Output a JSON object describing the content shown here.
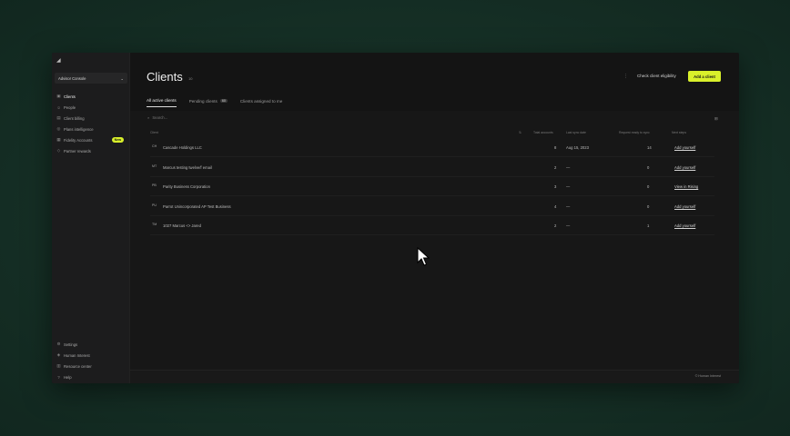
{
  "sidebar": {
    "workspace": "Advisor Console",
    "items": [
      {
        "label": "Clients",
        "icon": "clients-icon",
        "glyph": "▣",
        "active": true
      },
      {
        "label": "People",
        "icon": "people-icon",
        "glyph": "☺"
      },
      {
        "label": "Client billing",
        "icon": "billing-icon",
        "glyph": "▤"
      },
      {
        "label": "Plans intelligence",
        "icon": "plans-icon",
        "glyph": "◎"
      },
      {
        "label": "Fidelity Accounts",
        "icon": "accounts-icon",
        "glyph": "▦",
        "badge": "New"
      },
      {
        "label": "Partner rewards",
        "icon": "rewards-icon",
        "glyph": "◇"
      }
    ],
    "bottom_items": [
      {
        "label": "Settings",
        "icon": "gear-icon",
        "glyph": "⚙"
      },
      {
        "label": "Human Interest",
        "icon": "company-icon",
        "glyph": "◈"
      },
      {
        "label": "Resource center",
        "icon": "book-icon",
        "glyph": "▥"
      },
      {
        "label": "Help",
        "icon": "help-icon",
        "glyph": "?"
      }
    ]
  },
  "header": {
    "title": "Clients",
    "count": "10",
    "check_label": "Check client eligibility",
    "add_label": "Add a client"
  },
  "tabs": [
    {
      "label": "All active clients",
      "active": true
    },
    {
      "label": "Pending clients",
      "count": "60"
    },
    {
      "label": "Clients assigned to me"
    }
  ],
  "search": {
    "placeholder": "Search..."
  },
  "table": {
    "columns": [
      "Client",
      "Total accounts",
      "Last sync date",
      "Request ready to sync",
      "Next steps"
    ],
    "rows": [
      {
        "initials": "CH",
        "client": "Cascade Holdings LLC",
        "accounts": "8",
        "date": "Aug 15, 2023",
        "ready": "14",
        "action": "Add yourself"
      },
      {
        "initials": "MT",
        "client": "Marcus testing twelve/f email",
        "accounts": "2",
        "date": "—",
        "ready": "0",
        "action": "Add yourself"
      },
      {
        "initials": "PB",
        "client": "Parity Business Corporation",
        "accounts": "3",
        "date": "—",
        "ready": "0",
        "action": "View in Rising"
      },
      {
        "initials": "PU",
        "client": "Parrot Unincorporated AP Test Business",
        "accounts": "4",
        "date": "—",
        "ready": "0",
        "action": "Add yourself"
      },
      {
        "initials": "TM",
        "client": "1027 Marcus <> Jared",
        "accounts": "2",
        "date": "—",
        "ready": "1",
        "action": "Add yourself"
      }
    ]
  },
  "footer": {
    "text": "© Human Interest"
  }
}
